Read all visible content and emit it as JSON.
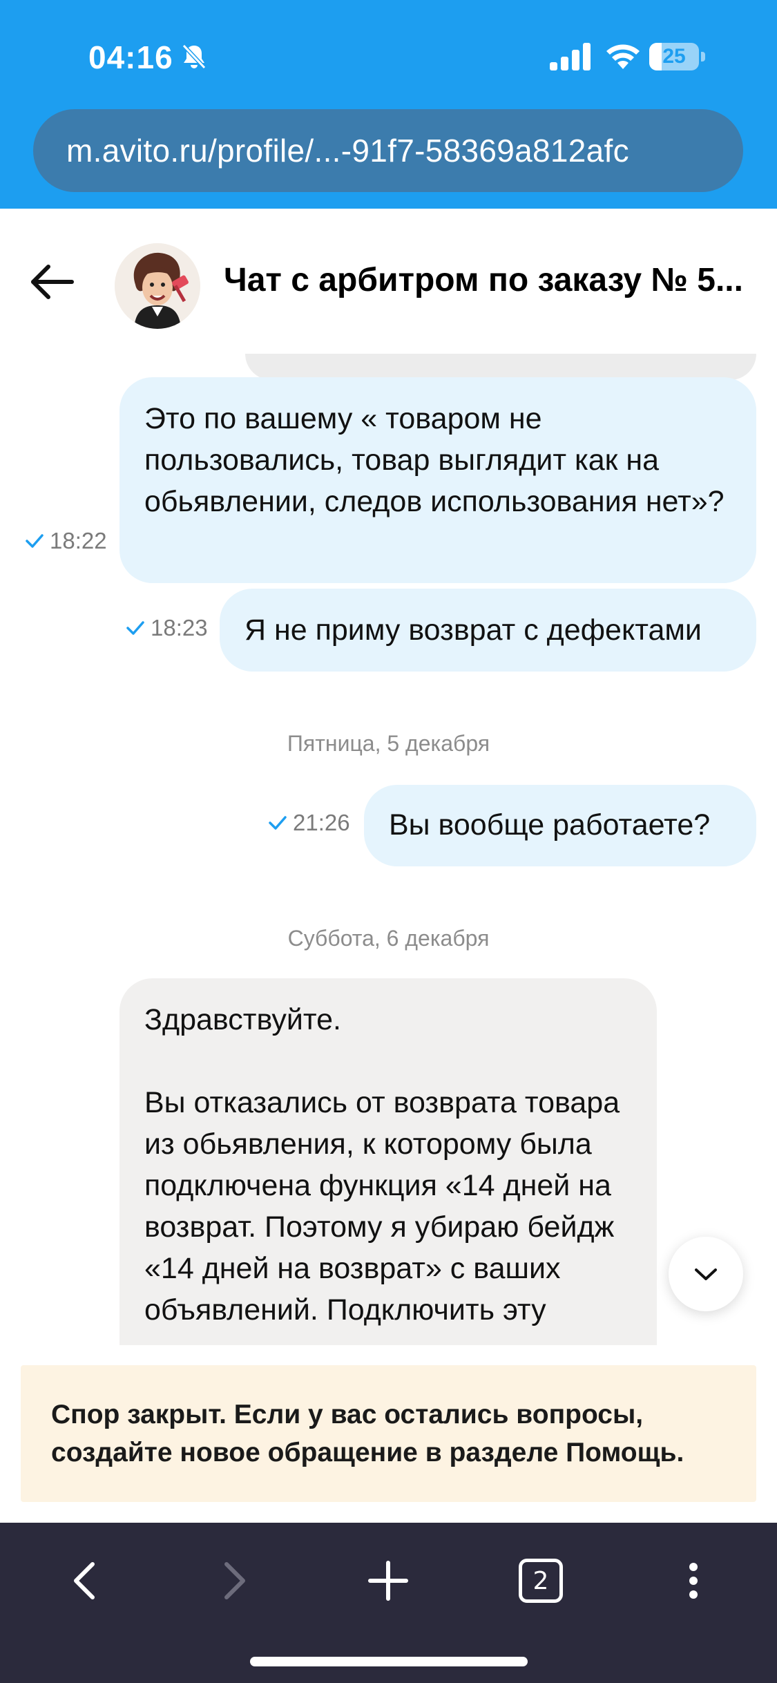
{
  "status_bar": {
    "time": "04:16",
    "battery_level": "25",
    "battery_fraction": 0.25,
    "icons": [
      "bell-slash-icon",
      "signal-icon",
      "wifi-icon",
      "battery-icon"
    ]
  },
  "browser": {
    "url": "m.avito.ru/profile/...-91f7-58369a812afc",
    "tabs_count": "2",
    "toolbar_icons": [
      "back-icon",
      "forward-icon",
      "new-tab-icon",
      "tabs-icon",
      "more-icon"
    ]
  },
  "header": {
    "title": "Чат с арбитром по заказу № 5..."
  },
  "messages": [
    {
      "direction": "out",
      "text": "Это по вашему « товаром не пользовались, товар выглядит как на обьявлении, следов использования нет»?",
      "time": "18:22"
    },
    {
      "direction": "out",
      "text": "Я не приму возврат с дефектами",
      "time": "18:23"
    },
    {
      "day": "Пятница, 5 декабря"
    },
    {
      "direction": "out",
      "text": "Вы вообще работаете?",
      "time": "21:26"
    },
    {
      "day": "Суббота, 6 декабря"
    },
    {
      "direction": "in",
      "text": "Здравствуйте.\n\nВы отказались от возврата товара из обьявления, к которому была подключена функция «14 дней на возврат. Поэтому я убираю бейдж «14 дней на возврат» с ваших объявлений. Подключить эту"
    }
  ],
  "notice": {
    "text": "Спор закрыт. Если у вас остались вопросы, создайте новое обращение в разделе Помощь."
  },
  "colors": {
    "brand_blue": "#1d9ef0",
    "outgoing_bubble": "#e5f4fd",
    "incoming_bubble": "#f1f0ef",
    "read_check": "#1d9ef0",
    "notice_bg": "#fdf3e2",
    "toolbar_bg": "#2b2a3c"
  }
}
